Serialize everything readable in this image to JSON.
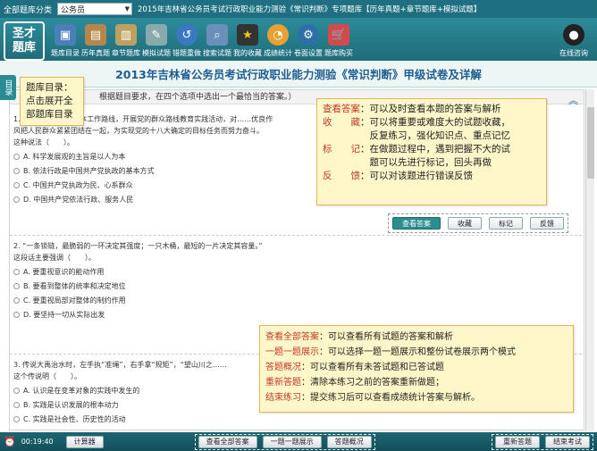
{
  "topbar": {
    "category_label": "全部题库分类",
    "category_value": "公务员",
    "title": "2015年吉林省公务员考试行政职业能力测验《常识判断》专项题库【历年真题+章节题库+模拟试题】"
  },
  "toolbar": {
    "logo": "圣才\n题库",
    "items": [
      {
        "label": "题库目录",
        "icon": "monitor-icon"
      },
      {
        "label": "历年真题",
        "icon": "scroll-icon"
      },
      {
        "label": "章节题库",
        "icon": "book-icon"
      },
      {
        "label": "模拟试题",
        "icon": "pencil-icon"
      },
      {
        "label": "错题重做",
        "icon": "redo-icon"
      },
      {
        "label": "搜索试题",
        "icon": "search-icon"
      },
      {
        "label": "我的收藏",
        "icon": "star-icon"
      },
      {
        "label": "成绩统计",
        "icon": "chart-icon"
      },
      {
        "label": "卷面设置",
        "icon": "gear-icon"
      },
      {
        "label": "题库购买",
        "icon": "cart-icon"
      }
    ],
    "online_label": "在线咨询"
  },
  "page_title": "2013年吉林省公务员考试行政职业能力测验《常识判断》甲级试卷及详解",
  "sidetab": "目录",
  "instruction": "根据题目要求，在四个选项中选出一个最恰当的答案。）",
  "questions": [
    {
      "lines": [
        "1. ……的生命线和根本工作路线，开展党的群众路线教育实践活动，对……优良作",
        "风把人民群众紧紧团结在一起，为实现党的十八大确定的目标任务而努力奋斗。",
        "这种说法（　　）。"
      ],
      "options": [
        "A. 科学发展观的主旨是以人为本",
        "B. 依法行政是中国共产党执政的基本方式",
        "C. 中国共产党执政为民、心系群众",
        "D. 中国共产党依法行政、服务人民"
      ]
    },
    {
      "lines": [
        "2. “一条锁链，最脆弱的一环决定其强度；一只木桶，最短的一片决定其容量。”",
        "这段话主要强调（　　）。"
      ],
      "options": [
        "A. 要重视意识的能动作用",
        "B. 要看到整体的统率和决定地位",
        "C. 要重视局部对整体的制约作用",
        "D. 要坚持一切从实际出发"
      ]
    },
    {
      "lines": [
        "3. 传说大禹治水时，左手执“准绳”，右手拿“规矩”，“望山川之……",
        "这个传说明（　　）。"
      ],
      "options": [
        "A. 认识是在变革对象的实践中发生的",
        "B. 实践是认识发展的根本动力",
        "C. 实践是社会性、历史性的活动"
      ]
    }
  ],
  "action_buttons": [
    "查看答案",
    "收藏",
    "标记",
    "反馈"
  ],
  "tips": {
    "catalog": [
      "题库目录：",
      "点击展开全",
      "部题库目录"
    ],
    "actions": [
      {
        "k": "查看答案",
        "v": "：可以及时查看本题的答案与解析"
      },
      {
        "k": "收　　藏",
        "v": "：可以将重要或难度大的试题收藏，"
      },
      {
        "k": "",
        "v": "　　　　　反复练习，强化知识点、重点记忆"
      },
      {
        "k": "标　　记",
        "v": "：在做题过程中，遇到把握不大的试"
      },
      {
        "k": "",
        "v": "　　　　　题可以先进行标记，回头再做"
      },
      {
        "k": "反　　馈",
        "v": "：可以对该题进行错误反馈"
      }
    ],
    "bottom": [
      {
        "k": "查看全部答案",
        "v": "：可以查看所有试题的答案和解析"
      },
      {
        "k": "一题一题展示",
        "v": "：可以选择一题一题展示和整份试卷展示两个模式"
      },
      {
        "k": "答题概况",
        "v": "：可以查看所有未答试题和已答试题"
      },
      {
        "k": "重新答题",
        "v": "：清除本练习之前的答案重新做题；"
      },
      {
        "k": "结束练习",
        "v": "：提交练习后可以查看成绩统计答案与解析。"
      }
    ]
  },
  "status": {
    "time": "00:19:40",
    "calculator": "计算器",
    "center_buttons": [
      "查看全部答案",
      "一题一题展示",
      "答题概况"
    ],
    "right_buttons": [
      "重新答题",
      "结束考试"
    ]
  }
}
